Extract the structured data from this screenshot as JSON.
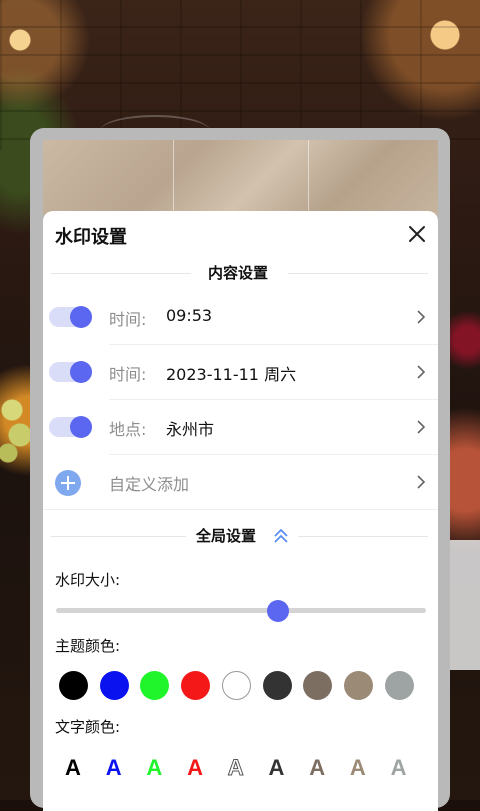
{
  "panel": {
    "title": "水印设置",
    "close_icon": "close-icon"
  },
  "content_section": {
    "title": "内容设置",
    "rows": [
      {
        "key": "时间:",
        "value": "09:53",
        "enabled": true
      },
      {
        "key": "时间:",
        "value": "2023-11-11 周六",
        "enabled": true
      },
      {
        "key": "地点:",
        "value": "永州市",
        "enabled": true
      }
    ],
    "add_label": "自定义添加"
  },
  "global_section": {
    "title": "全局设置",
    "collapse_icon": "double-chevron-up-icon",
    "size_label": "水印大小:",
    "size_value": 0.6,
    "theme_color_label": "主题颜色:",
    "theme_colors": [
      "#000000",
      "#0a12f0",
      "#1ff52a",
      "#f41818",
      "#ffffff",
      "#333333",
      "#7d6e62",
      "#9b8a76",
      "#9ea4a3"
    ],
    "text_color_label": "文字颜色:",
    "text_glyph": "A",
    "text_colors": [
      "#000000",
      "#0a12f0",
      "#1ff52a",
      "#f41818",
      "#ffffff",
      "#333333",
      "#7d6e62",
      "#9b8a76",
      "#9ea4a3"
    ]
  },
  "accent_color": "#5b67f0"
}
